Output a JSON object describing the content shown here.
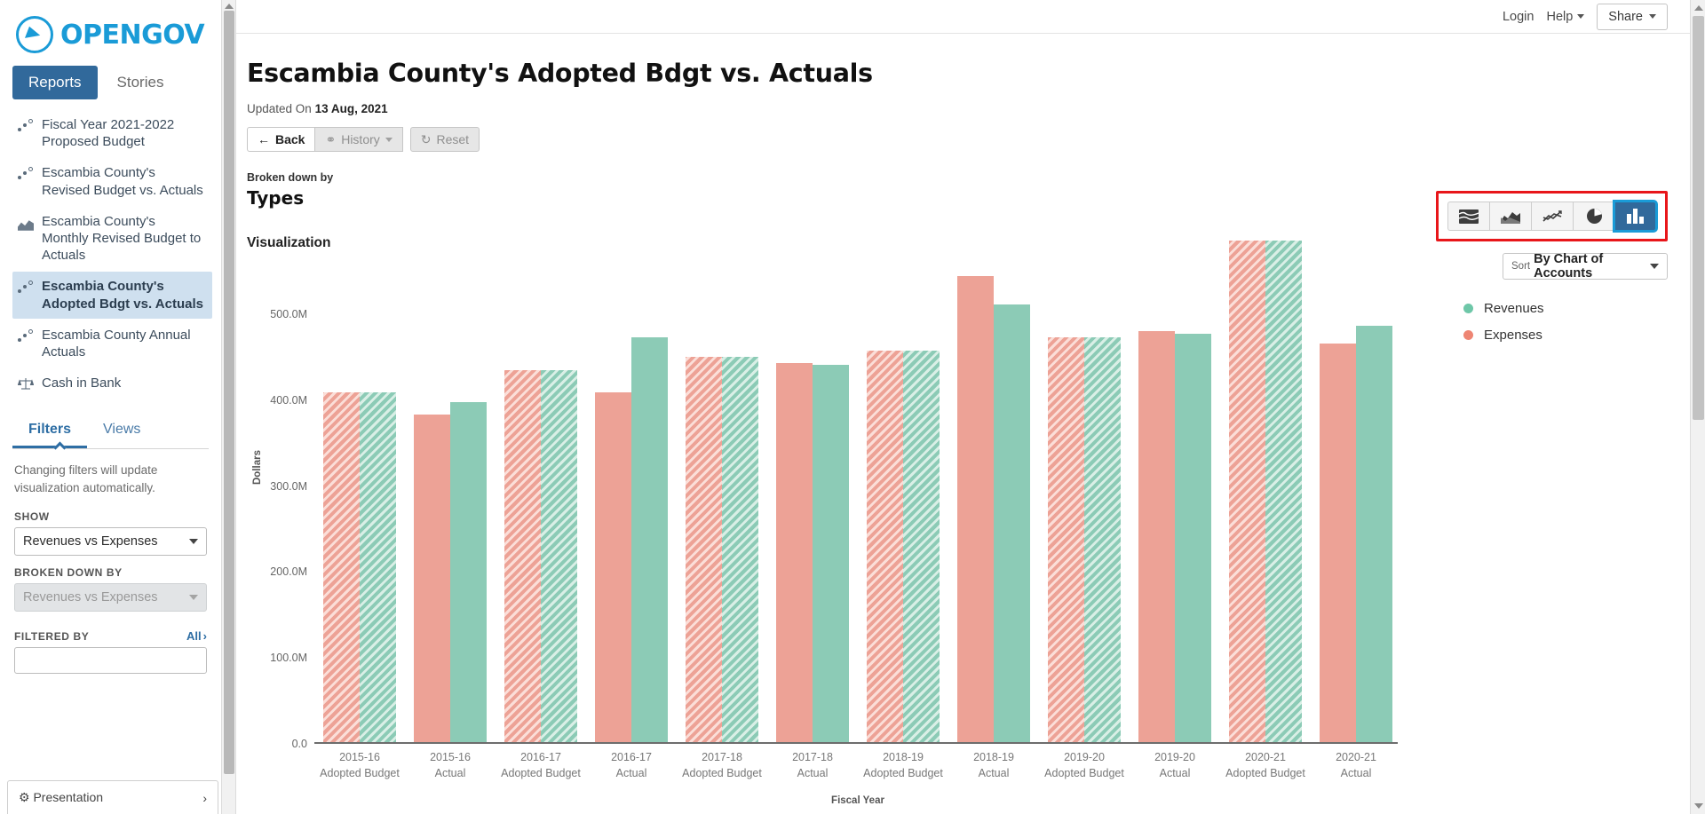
{
  "brand": {
    "name": "OPENGOV",
    "logo_icon": "opengov-logo-icon"
  },
  "topbar": {
    "login": "Login",
    "help": "Help",
    "share": "Share"
  },
  "sidebar": {
    "tabs": [
      {
        "label": "Reports",
        "active": true
      },
      {
        "label": "Stories",
        "active": false
      }
    ],
    "reports": [
      {
        "label": "Fiscal Year 2021-2022 Proposed Budget",
        "icon": "scatter-icon",
        "active": false
      },
      {
        "label": "Escambia County's Revised Budget vs. Actuals",
        "icon": "scatter-icon",
        "active": false
      },
      {
        "label": "Escambia County's Monthly Revised Budget to Actuals",
        "icon": "area-icon",
        "active": false
      },
      {
        "label": "Escambia County's Adopted Bdgt vs. Actuals",
        "icon": "scatter-icon",
        "active": true
      },
      {
        "label": "Escambia County Annual Actuals",
        "icon": "scatter-icon",
        "active": false
      },
      {
        "label": "Cash in Bank",
        "icon": "scale-icon",
        "active": false
      }
    ],
    "panel_tabs": [
      {
        "label": "Filters",
        "active": true
      },
      {
        "label": "Views",
        "active": false
      }
    ],
    "filters_note": "Changing filters will update visualization automatically.",
    "show_label": "SHOW",
    "show_value": "Revenues vs Expenses",
    "broken_down_by_label": "BROKEN DOWN BY",
    "broken_down_by_value": "Revenues vs Expenses",
    "filtered_by_label": "FILTERED BY",
    "filtered_by_all": "All",
    "presentation": "Presentation"
  },
  "main": {
    "title": "Escambia County's Adopted Bdgt vs. Actuals",
    "updated_prefix": "Updated On",
    "updated_date": "13 Aug, 2021",
    "back_label": "Back",
    "history_label": "History",
    "reset_label": "Reset",
    "broken_down_by_label": "Broken down by",
    "broken_down_by_value": "Types",
    "visualization_label": "Visualization",
    "sort_prefix": "Sort",
    "sort_value": "By Chart of Accounts",
    "chart_tools": [
      {
        "icon": "stacked-area-icon",
        "active": false
      },
      {
        "icon": "area-chart-icon",
        "active": false
      },
      {
        "icon": "line-chart-icon",
        "active": false
      },
      {
        "icon": "pie-chart-icon",
        "active": false
      },
      {
        "icon": "bar-chart-icon",
        "active": true
      }
    ],
    "legend": [
      {
        "label": "Revenues",
        "color": "#6ec7a8"
      },
      {
        "label": "Expenses",
        "color": "#ee8573"
      }
    ]
  },
  "colors": {
    "accent_blue": "#31699b",
    "brand_blue": "#1a9bd7",
    "highlight_red": "#e8161a",
    "revenues": "#8ccbb6",
    "expenses": "#eda296"
  },
  "chart_data": {
    "type": "bar",
    "title": "",
    "xlabel": "Fiscal Year",
    "ylabel": "Dollars",
    "ylim": [
      0,
      560
    ],
    "yticks": [
      0,
      100,
      200,
      300,
      400,
      500
    ],
    "ytick_labels": [
      "0.0",
      "100.0M",
      "200.0M",
      "300.0M",
      "400.0M",
      "500.0M"
    ],
    "grid": false,
    "legend_position": "right",
    "units": "millions of dollars",
    "categories": [
      "2015-16 Adopted Budget",
      "2015-16 Actual",
      "2016-17 Adopted Budget",
      "2016-17 Actual",
      "2017-18 Adopted Budget",
      "2017-18 Actual",
      "2018-19 Adopted Budget",
      "2018-19 Actual",
      "2019-20 Adopted Budget",
      "2019-20 Actual",
      "2020-21 Adopted Budget",
      "2020-21 Actual"
    ],
    "category_hatched": [
      true,
      false,
      true,
      false,
      true,
      false,
      true,
      false,
      true,
      false,
      true,
      false
    ],
    "series": [
      {
        "name": "Expenses",
        "color": "#eda296",
        "values": [
          409,
          383,
          435,
          409,
          450,
          443,
          458,
          545,
          473,
          480,
          586,
          466
        ]
      },
      {
        "name": "Revenues",
        "color": "#8ccbb6",
        "values": [
          409,
          398,
          435,
          473,
          450,
          441,
          458,
          511,
          473,
          477,
          586,
          487
        ]
      }
    ]
  }
}
